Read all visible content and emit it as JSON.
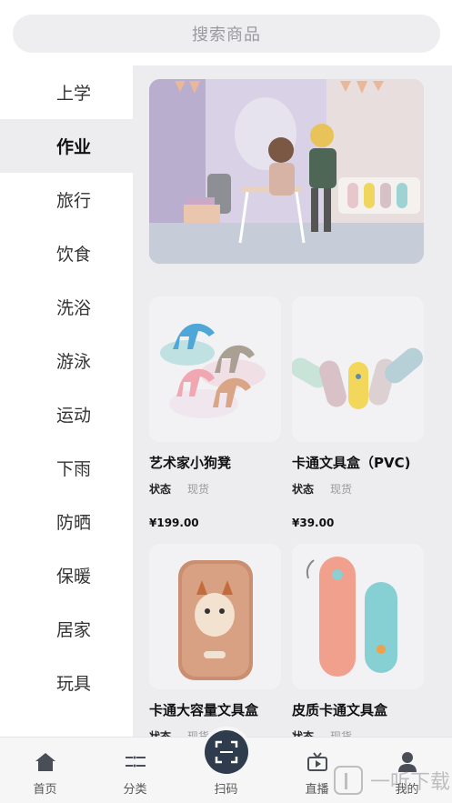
{
  "search": {
    "placeholder": "搜索商品"
  },
  "sidebar": {
    "items": [
      {
        "label": "上学",
        "active": false
      },
      {
        "label": "作业",
        "active": true
      },
      {
        "label": "旅行",
        "active": false
      },
      {
        "label": "饮食",
        "active": false
      },
      {
        "label": "洗浴",
        "active": false
      },
      {
        "label": "游泳",
        "active": false
      },
      {
        "label": "运动",
        "active": false
      },
      {
        "label": "下雨",
        "active": false
      },
      {
        "label": "防晒",
        "active": false
      },
      {
        "label": "保暖",
        "active": false
      },
      {
        "label": "居家",
        "active": false
      },
      {
        "label": "玩具",
        "active": false
      }
    ]
  },
  "products": [
    {
      "name": "艺术家小狗凳",
      "status_label": "状态",
      "status_value": "现货",
      "price": "¥199.00"
    },
    {
      "name": "卡通文具盒（PVC)",
      "status_label": "状态",
      "status_value": "现货",
      "price": "¥39.00"
    },
    {
      "name": "卡通大容量文具盒",
      "status_label": "状态",
      "status_value": "现货",
      "price": ""
    },
    {
      "name": "皮质卡通文具盒",
      "status_label": "状态",
      "status_value": "现货",
      "price": ""
    }
  ],
  "tabbar": {
    "home": "首页",
    "category": "分类",
    "scan": "扫码",
    "live": "直播",
    "mine": "我的"
  },
  "watermark": {
    "text": "一听下载"
  },
  "colors": {
    "accent": "#2f3c4d",
    "active_bg": "#ededf0",
    "page_bg": "#ededf0"
  }
}
